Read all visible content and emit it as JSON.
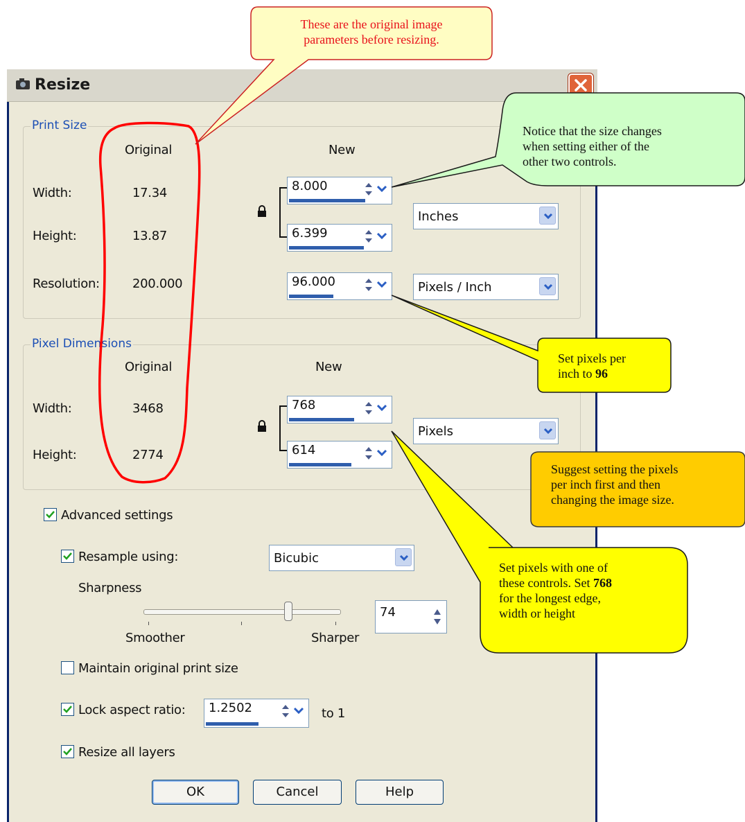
{
  "window": {
    "title": "Resize"
  },
  "print_size": {
    "legend": "Print Size",
    "original_header": "Original",
    "new_header": "New",
    "width_label": "Width:",
    "height_label": "Height:",
    "resolution_label": "Resolution:",
    "orig_width": "17.34",
    "orig_height": "13.87",
    "orig_resolution": "200.000",
    "new_width": "8.000",
    "new_height": "6.399",
    "new_resolution": "96.000",
    "size_unit": "Inches",
    "resolution_unit": "Pixels / Inch"
  },
  "pixel_dimensions": {
    "legend": "Pixel Dimensions",
    "original_header": "Original",
    "new_header": "New",
    "width_label": "Width:",
    "height_label": "Height:",
    "orig_width": "3468",
    "orig_height": "2774",
    "new_width": "768",
    "new_height": "614",
    "unit": "Pixels"
  },
  "advanced": {
    "advanced_settings_label": "Advanced settings",
    "advanced_settings_checked": true,
    "resample_label": "Resample using:",
    "resample_checked": true,
    "resample_method": "Bicubic",
    "sharpness_label": "Sharpness",
    "smoother_label": "Smoother",
    "sharper_label": "Sharper",
    "sharpness_value": "74",
    "maintain_label": "Maintain original print size",
    "maintain_checked": false,
    "lock_aspect_label": "Lock aspect ratio:",
    "lock_aspect_checked": true,
    "aspect_value": "1.2502",
    "aspect_suffix": "to 1",
    "resize_layers_label": "Resize all layers",
    "resize_layers_checked": true
  },
  "buttons": {
    "ok": "OK",
    "cancel": "Cancel",
    "help": "Help"
  },
  "callouts": {
    "original_note_line1": "These are the original image",
    "original_note_line2": "parameters before resizing.",
    "size_note_line1": "Notice that the size changes",
    "size_note_line2": "when setting either of the",
    "size_note_line3": "other two controls.",
    "ppi_note_line1": "Set pixels per",
    "ppi_note_line2_prefix": "inch to ",
    "ppi_note_bold": "96",
    "order_note_line1": "Suggest setting the pixels",
    "order_note_line2": "per inch first and then",
    "order_note_line3": "changing the image size.",
    "pixels_note_line1": "Set pixels with one of",
    "pixels_note_line2_prefix": "these controls. Set ",
    "pixels_note_bold": "768",
    "pixels_note_line3": "for the longest edge,",
    "pixels_note_line4": "width or height"
  },
  "colors": {
    "callout_red_text": "#e8111b",
    "callout_yellow_fill": "#fffdc3",
    "callout_green_fill": "#cfffc8",
    "callout_bright_yellow": "#ffff00",
    "callout_orange": "#ffcc00",
    "annotation_red": "#ff0000",
    "progress_blue": "#2f5eac"
  },
  "icons": {
    "title": "resize-dialog-icon",
    "lock": "lock-icon",
    "close": "close-x-icon"
  }
}
